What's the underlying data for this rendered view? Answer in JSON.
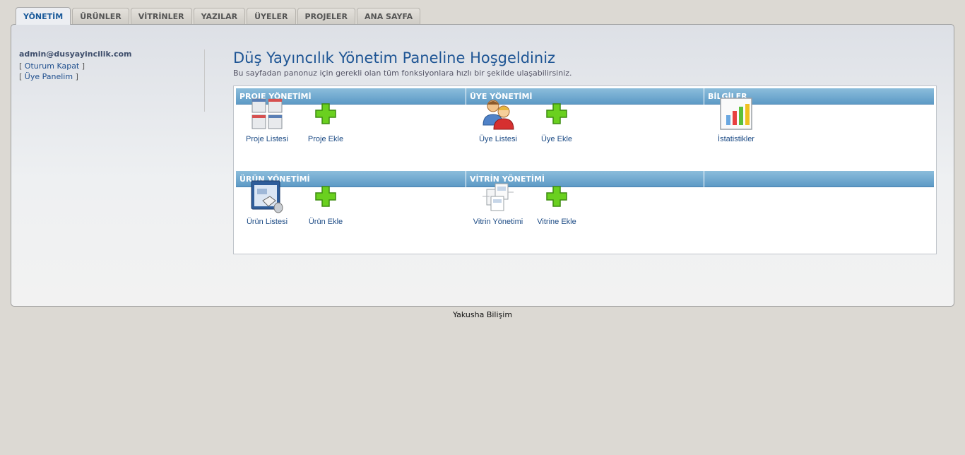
{
  "tabs": [
    {
      "label": "YÖNETİM",
      "active": true
    },
    {
      "label": "ÜRÜNLER"
    },
    {
      "label": "VİTRİNLER"
    },
    {
      "label": "YAZILAR"
    },
    {
      "label": "ÜYELER"
    },
    {
      "label": "PROJELER"
    },
    {
      "label": "ANA SAYFA"
    }
  ],
  "sidebar": {
    "email": "admin@dusyayincilik.com",
    "logout": "Oturum Kapat",
    "my_panel": "Üye Panelim"
  },
  "main": {
    "title": "Düş Yayıncılık Yönetim Paneline Hoşgeldiniz",
    "subtitle": "Bu sayfadan panonuz için gerekli olan tüm fonksiyonlara hızlı bir şekilde ulaşabilirsiniz."
  },
  "sections": {
    "proje": {
      "title": "PROJE YÖNETİMİ",
      "list": "Proje Listesi",
      "add": "Proje Ekle"
    },
    "uye": {
      "title": "ÜYE YÖNETİMİ",
      "list": "Üye Listesi",
      "add": "Üye Ekle"
    },
    "bilgi": {
      "title": "BİLGİLER",
      "stats": "İstatistikler"
    },
    "urun": {
      "title": "ÜRÜN YÖNETİMİ",
      "list": "Ürün Listesi",
      "add": "Ürün Ekle"
    },
    "vitrin": {
      "title": "VİTRİN YÖNETİMİ",
      "manage": "Vitrin Yönetimi",
      "add": "Vitrine Ekle"
    },
    "empty": {
      "title": ""
    }
  },
  "footer": "Yakusha Bilişim",
  "colors": {
    "accent": "#1e5594",
    "header_blue": "#5d9ac6",
    "plus_green": "#6ad01f"
  }
}
